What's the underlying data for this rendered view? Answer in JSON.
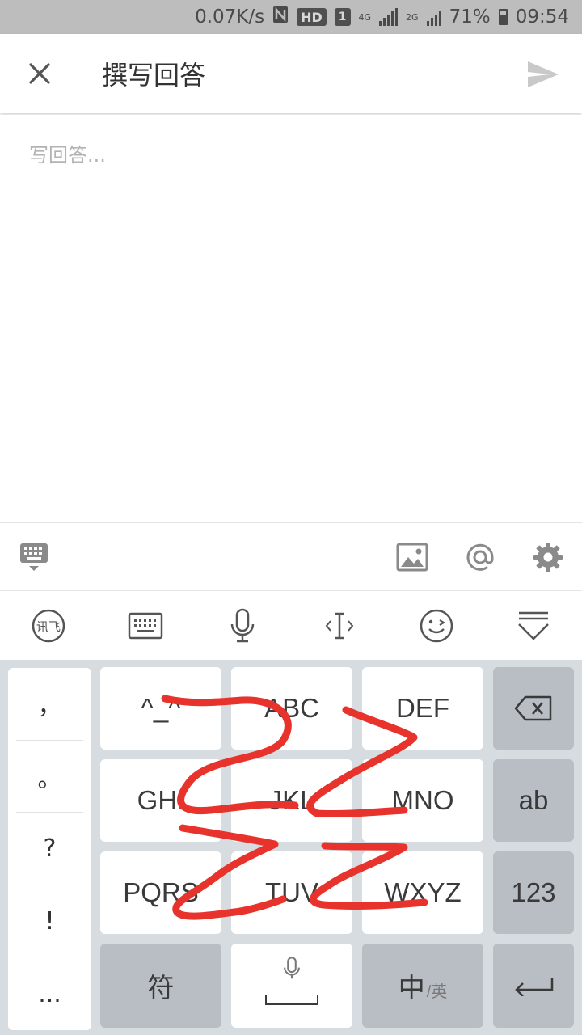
{
  "status_bar": {
    "speed": "0.07K/s",
    "hd": "HD",
    "sim_slot": "1",
    "network_4g": "4G",
    "network_2g": "2G",
    "battery": "71%",
    "time": "09:54"
  },
  "app_bar": {
    "title": "撰写回答"
  },
  "editor": {
    "placeholder": "写回答...",
    "value": ""
  },
  "ime": {
    "logo_text": "讯飞",
    "symbols": [
      "，",
      "。",
      "?",
      "!",
      "..."
    ],
    "keys": {
      "r1c1": "^_^",
      "r1c2": "ABC",
      "r1c3": "DEF",
      "r2c1": "GHI",
      "r2c2": "JKL",
      "r2c3": "MNO",
      "r2c4": "ab",
      "r3c1": "PQRS",
      "r3c2": "TUV",
      "r3c3": "WXYZ",
      "r3c4": "123",
      "r4c1": "符",
      "r4c3_main": "中",
      "r4c3_sub": "/英"
    }
  },
  "colors": {
    "scribble": "#e8322c",
    "keyboard_bg": "#d7dce0",
    "func_key": "#b8bec4",
    "status_bar": "#bdbdbd"
  }
}
